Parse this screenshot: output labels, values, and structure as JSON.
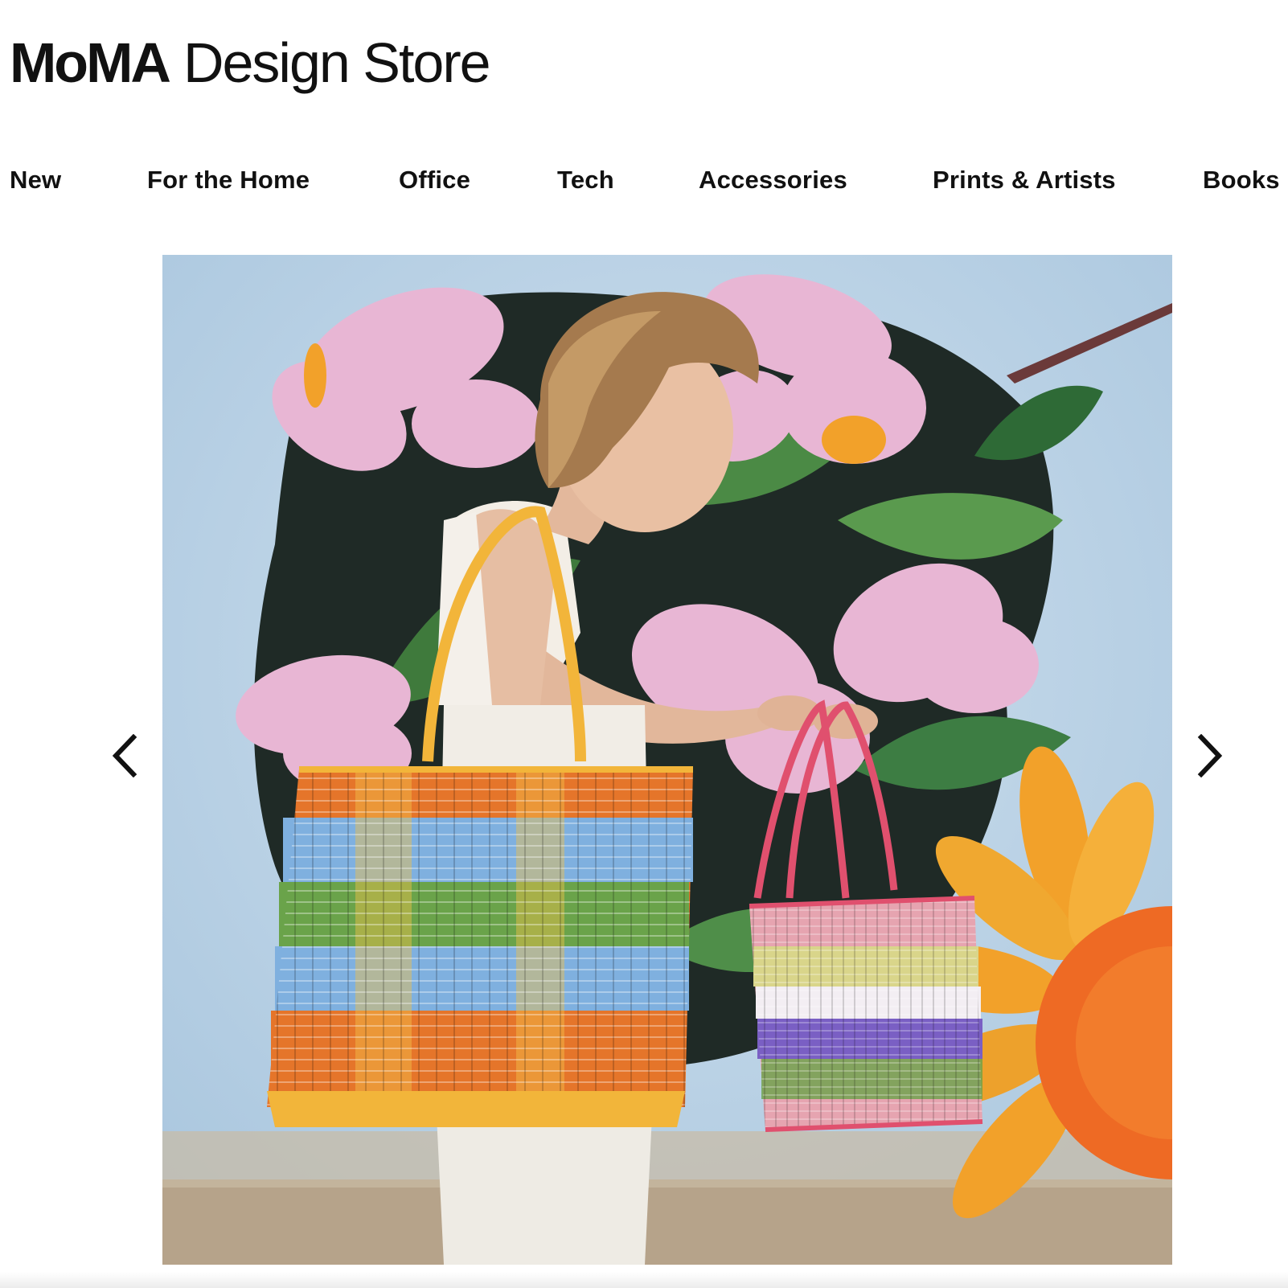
{
  "header": {
    "logo_bold": "MoMA",
    "logo_light": "Design Store"
  },
  "nav": {
    "items": [
      {
        "label": "New"
      },
      {
        "label": "For the Home"
      },
      {
        "label": "Office"
      },
      {
        "label": "Tech"
      },
      {
        "label": "Accessories"
      },
      {
        "label": "Prints & Artists"
      },
      {
        "label": "Books"
      }
    ]
  },
  "carousel": {
    "prev_icon": "chevron-left-icon",
    "next_icon": "chevron-right-icon",
    "image_subject": "Woman holding two woven plastic tote baskets in front of a floral mural"
  },
  "colors": {
    "text": "#111111",
    "background": "#ffffff",
    "mural_sky": "#b9d3e6",
    "orchid_pink": "#e8b6d4",
    "leaf_green": "#3f7a3c",
    "sunflower_orange": "#f2a12a",
    "basket_orange": "#e5752a",
    "basket_blue": "#7fb0df",
    "basket_pink": "#e0506e"
  }
}
